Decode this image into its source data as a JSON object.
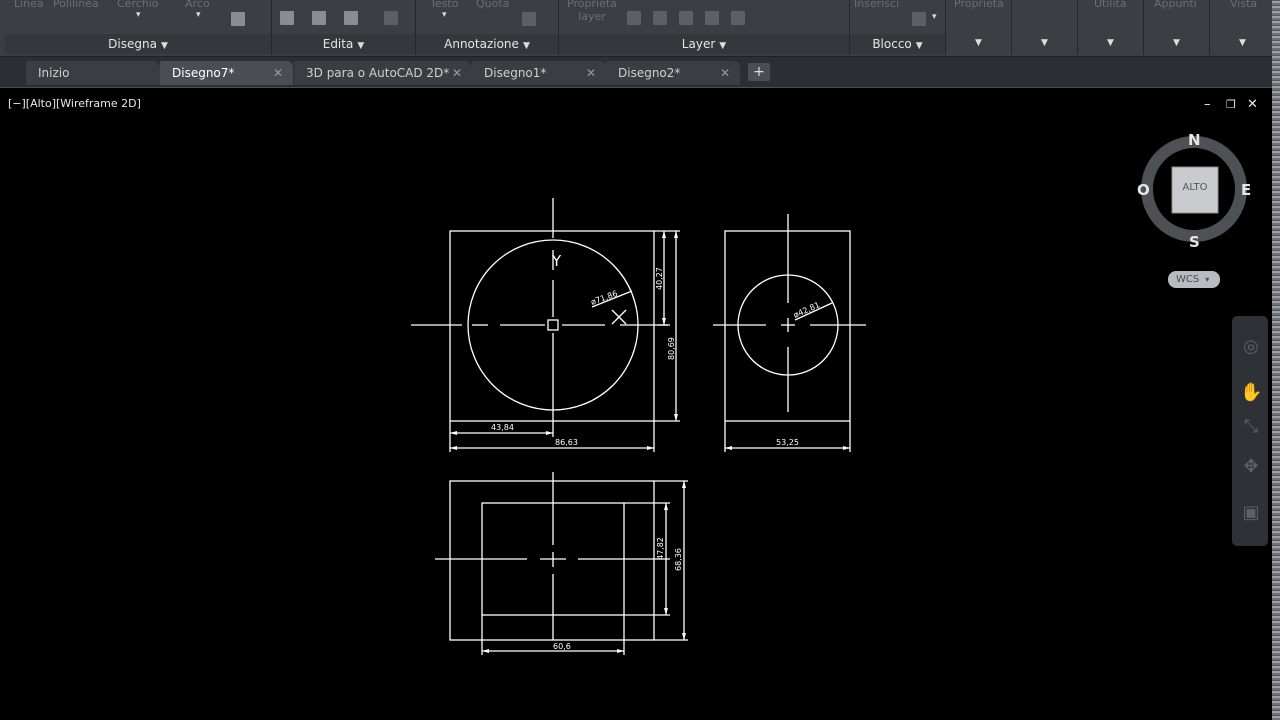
{
  "ribbon": {
    "panels": [
      {
        "title": "Disegna",
        "tools": [
          "Linea",
          "Polilinea",
          "Cerchio",
          "Arco"
        ]
      },
      {
        "title": "Edita",
        "tools": []
      },
      {
        "title": "Annotazione",
        "tools": [
          "Testo",
          "Quota"
        ]
      },
      {
        "title": "Layer",
        "tools": [
          "Proprietà layer"
        ]
      },
      {
        "title": "Blocco",
        "tools": [
          "Inserisci"
        ]
      }
    ],
    "extra_panels": [
      "Proprietà",
      "",
      "Utilità",
      "Appunti",
      "Vista"
    ]
  },
  "tabs": [
    {
      "label": "Inizio",
      "active": false,
      "closable": false
    },
    {
      "label": "Disegno7*",
      "active": true,
      "closable": true
    },
    {
      "label": "3D para o AutoCAD 2D*",
      "active": false,
      "closable": true
    },
    {
      "label": "Disegno1*",
      "active": false,
      "closable": true
    },
    {
      "label": "Disegno2*",
      "active": false,
      "closable": true
    }
  ],
  "viewport": {
    "label": "[−][Alto][Wireframe 2D]",
    "controls": {
      "minimize": "–",
      "restore": "❐",
      "close": "✕"
    }
  },
  "viewcube": {
    "face": "ALTO",
    "north": "N",
    "south": "S",
    "east": "E",
    "west": "O",
    "wcs": "WCS"
  },
  "drawing": {
    "dims": {
      "top_radius": "ø71,86",
      "top_height_upper": "40,27",
      "top_height_total": "80,69",
      "top_offset": "43,84",
      "top_width": "86,63",
      "side_radius": "ø42,81",
      "side_width": "53,25",
      "front_inner_height": "47,82",
      "front_height": "68,36",
      "front_inner_width": "60,6"
    },
    "ucs_y": "Y"
  },
  "colors": {
    "ribbon": "#3a3d42",
    "canvas": "#000000",
    "lines": "#ffffff"
  }
}
